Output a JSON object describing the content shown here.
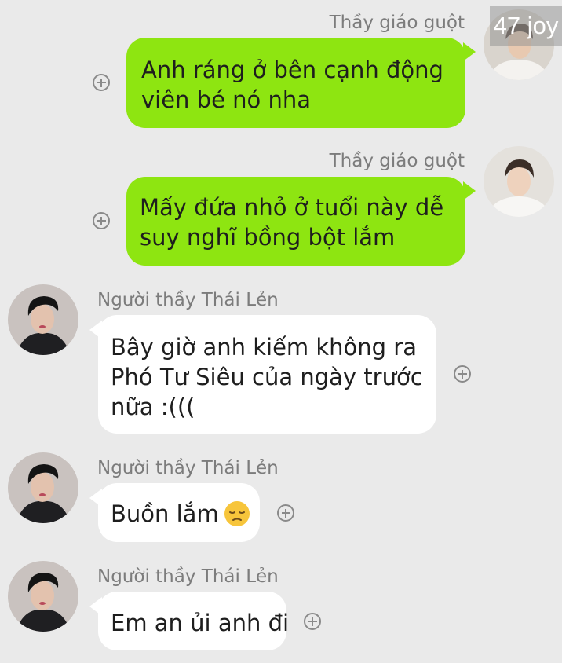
{
  "watermark": "47 joy",
  "messages": [
    {
      "sender": "Thầy giáo guột",
      "side": "right",
      "lines": [
        "Anh ráng ở bên cạnh động",
        "viên bé nó nha"
      ]
    },
    {
      "sender": "Thầy giáo guột",
      "side": "right",
      "lines": [
        "Mấy đứa nhỏ ở tuổi này dễ",
        "suy nghĩ  bồng bột lắm"
      ]
    },
    {
      "sender": "Người thầy Thái Lẻn",
      "side": "left",
      "lines": [
        "Bây giờ anh kiếm không ra",
        "Phó Tư Siêu của ngày trước",
        "nữa :((("
      ]
    },
    {
      "sender": "Người thầy Thái Lẻn",
      "side": "left",
      "lines": [
        "Buồn lắm"
      ],
      "emoji": "pensive-face"
    },
    {
      "sender": "Người thầy Thái Lẻn",
      "side": "left",
      "lines": [
        "Em an ủi anh đi"
      ]
    }
  ],
  "colors": {
    "background": "#eaeaea",
    "outgoing_bubble": "#8ee511",
    "incoming_bubble": "#ffffff",
    "sender_name": "#7c7c7c"
  }
}
